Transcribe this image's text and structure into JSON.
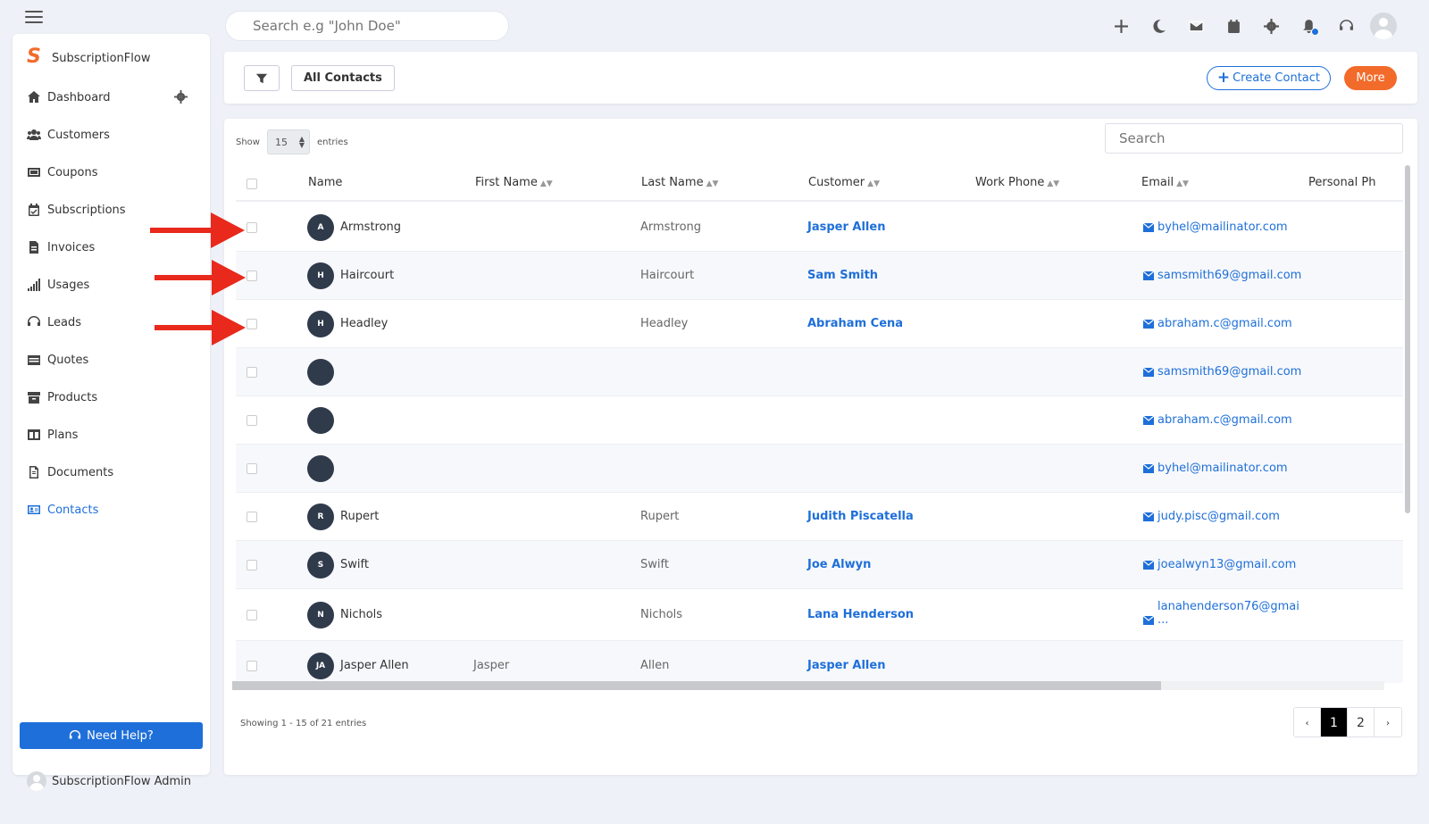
{
  "topbar": {
    "search_placeholder": "Search e.g \"John Doe\"",
    "icons": [
      "plus-icon",
      "moon-icon",
      "mail-icon",
      "calendar-icon",
      "gear-icon",
      "bell-icon",
      "headset-icon"
    ],
    "notification_dot_color": "#1e6fd9"
  },
  "sidebar": {
    "brand": "SubscriptionFlow",
    "items": [
      {
        "label": "Dashboard",
        "icon": "home-icon"
      },
      {
        "label": "Customers",
        "icon": "users-icon"
      },
      {
        "label": "Coupons",
        "icon": "ticket-icon"
      },
      {
        "label": "Subscriptions",
        "icon": "calendar-check-icon"
      },
      {
        "label": "Invoices",
        "icon": "invoice-icon"
      },
      {
        "label": "Usages",
        "icon": "signal-icon"
      },
      {
        "label": "Leads",
        "icon": "headset-icon"
      },
      {
        "label": "Quotes",
        "icon": "quote-icon"
      },
      {
        "label": "Products",
        "icon": "archive-icon"
      },
      {
        "label": "Plans",
        "icon": "columns-icon"
      },
      {
        "label": "Documents",
        "icon": "document-icon"
      },
      {
        "label": "Contacts",
        "icon": "contact-card-icon",
        "active": true
      }
    ],
    "need_help": "Need Help?",
    "admin": "SubscriptionFlow Admin"
  },
  "toolbar": {
    "view": "All Contacts",
    "create": "Create Contact",
    "more": "More"
  },
  "table": {
    "show_label": "Show",
    "entries_value": "15",
    "entries_label": "entries",
    "search_placeholder": "Search",
    "columns": [
      "Name",
      "First Name",
      "Last Name",
      "Customer",
      "Work Phone",
      "Email",
      "Personal Ph"
    ],
    "rows": [
      {
        "initials": "A",
        "name": "Armstrong",
        "first": "",
        "last": "Armstrong",
        "customer": "Jasper Allen",
        "email": "byhel@mailinator.com",
        "email_cont": ""
      },
      {
        "initials": "H",
        "name": "Haircourt",
        "first": "",
        "last": "Haircourt",
        "customer": "Sam Smith",
        "email": "samsmith69@gmail.com",
        "email_cont": ""
      },
      {
        "initials": "H",
        "name": "Headley",
        "first": "",
        "last": "Headley",
        "customer": "Abraham Cena",
        "email": "abraham.c@gmail.com",
        "email_cont": ""
      },
      {
        "initials": "",
        "name": "",
        "first": "",
        "last": "",
        "customer": "",
        "email": "samsmith69@gmail.com",
        "email_cont": ""
      },
      {
        "initials": "",
        "name": "",
        "first": "",
        "last": "",
        "customer": "",
        "email": "abraham.c@gmail.com",
        "email_cont": ""
      },
      {
        "initials": "",
        "name": "",
        "first": "",
        "last": "",
        "customer": "",
        "email": "byhel@mailinator.com",
        "email_cont": ""
      },
      {
        "initials": "R",
        "name": "Rupert",
        "first": "",
        "last": "Rupert",
        "customer": "Judith Piscatella",
        "email": "judy.pisc@gmail.com",
        "email_cont": ""
      },
      {
        "initials": "S",
        "name": "Swift",
        "first": "",
        "last": "Swift",
        "customer": "Joe Alwyn",
        "email": "joealwyn13@gmail.com",
        "email_cont": ""
      },
      {
        "initials": "N",
        "name": "Nichols",
        "first": "",
        "last": "Nichols",
        "customer": "Lana Henderson",
        "email": "lanahenderson76@gmai",
        "email_cont": "..."
      },
      {
        "initials": "JA",
        "name": "Jasper Allen",
        "first": "Jasper",
        "last": "Allen",
        "customer": "Jasper Allen",
        "email": "",
        "email_cont": ""
      }
    ],
    "showing": "Showing 1 - 15 of 21 entries",
    "pager": {
      "prev": "‹",
      "pages": [
        "1",
        "2"
      ],
      "next": "›",
      "current": "1"
    }
  },
  "annotations": {
    "arrow_color": "#e8291c"
  }
}
